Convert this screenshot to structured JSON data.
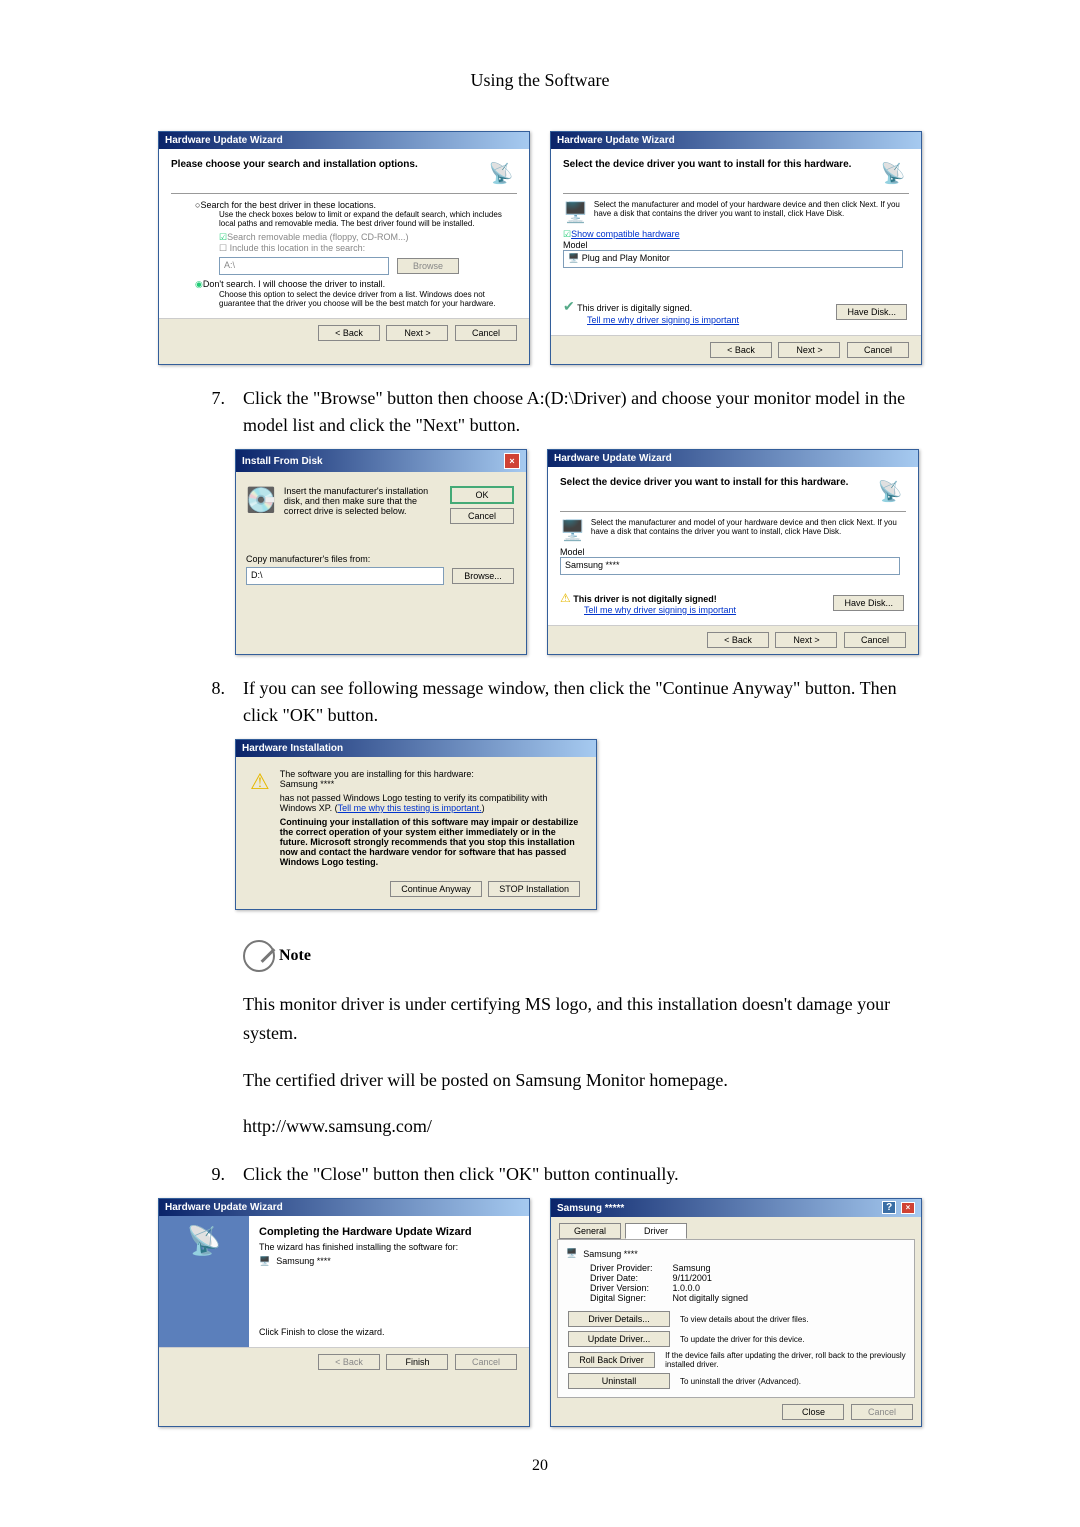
{
  "header": {
    "title": "Using the Software"
  },
  "step7": {
    "num": "7.",
    "text": "Click the \"Browse\" button then choose A:(D:\\Driver) and choose your monitor model in the model list and click the \"Next\" button."
  },
  "step8": {
    "num": "8.",
    "text": "If you can see following message window, then click the \"Continue Anyway\" button. Then click \"OK\" button."
  },
  "step9": {
    "num": "9.",
    "text": "Click the \"Close\" button then click \"OK\" button continually."
  },
  "note": {
    "label": "Note",
    "p1": "This monitor driver is under certifying MS logo, and this installation doesn't damage your system.",
    "p2": "The certified driver will be posted on Samsung Monitor homepage.",
    "url": "http://www.samsung.com/"
  },
  "dlg1": {
    "title": "Hardware Update Wizard",
    "head": "Please choose your search and installation options.",
    "opt1": "Search for the best driver in these locations.",
    "opt1_desc": "Use the check boxes below to limit or expand the default search, which includes local paths and removable media. The best driver found will be installed.",
    "chk1": "Search removable media (floppy, CD-ROM...)",
    "chk2": "Include this location in the search:",
    "path": "A:\\",
    "browse": "Browse",
    "opt2": "Don't search. I will choose the driver to install.",
    "opt2_desc": "Choose this option to select the device driver from a list. Windows does not guarantee that the driver you choose will be the best match for your hardware.",
    "back": "< Back",
    "next": "Next >",
    "cancel": "Cancel"
  },
  "dlg2": {
    "title": "Hardware Update Wizard",
    "head": "Select the device driver you want to install for this hardware.",
    "desc": "Select the manufacturer and model of your hardware device and then click Next. If you have a disk that contains the driver you want to install, click Have Disk.",
    "show_compat": "Show compatible hardware",
    "model_label": "Model",
    "model_row": "Plug and Play Monitor",
    "signed": "This driver is digitally signed.",
    "tell": "Tell me why driver signing is important",
    "have_disk": "Have Disk...",
    "back": "< Back",
    "next": "Next >",
    "cancel": "Cancel"
  },
  "dlg3": {
    "title": "Install From Disk",
    "msg": "Insert the manufacturer's installation disk, and then make sure that the correct drive is selected below.",
    "ok": "OK",
    "cancel": "Cancel",
    "copy_label": "Copy manufacturer's files from:",
    "path": "D:\\",
    "browse": "Browse..."
  },
  "dlg4": {
    "title": "Hardware Update Wizard",
    "head": "Select the device driver you want to install for this hardware.",
    "desc": "Select the manufacturer and model of your hardware device and then click Next. If you have a disk that contains the driver you want to install, click Have Disk.",
    "model_label": "Model",
    "model_row": "Samsung ****",
    "notsigned": "This driver is not digitally signed!",
    "tell": "Tell me why driver signing is important",
    "have_disk": "Have Disk...",
    "back": "< Back",
    "next": "Next >",
    "cancel": "Cancel"
  },
  "dlg5": {
    "title": "Hardware Installation",
    "line1": "The software you are installing for this hardware:",
    "hw": "Samsung ****",
    "line2": "has not passed Windows Logo testing to verify its compatibility with Windows XP. (",
    "tell": "Tell me why this testing is important.",
    "line2b": ")",
    "warn": "Continuing your installation of this software may impair or destabilize the correct operation of your system either immediately or in the future. Microsoft strongly recommends that you stop this installation now and contact the hardware vendor for software that has passed Windows Logo testing.",
    "continue": "Continue Anyway",
    "stop": "STOP Installation"
  },
  "dlg6": {
    "title": "Hardware Update Wizard",
    "head": "Completing the Hardware Update Wizard",
    "line1": "The wizard has finished installing the software for:",
    "hw": "Samsung ****",
    "line2": "Click Finish to close the wizard.",
    "back": "< Back",
    "finish": "Finish",
    "cancel": "Cancel"
  },
  "dlg7": {
    "title": "Samsung *****",
    "tab1": "General",
    "tab2": "Driver",
    "hw": "Samsung ****",
    "prov_l": "Driver Provider:",
    "prov_v": "Samsung",
    "date_l": "Driver Date:",
    "date_v": "9/11/2001",
    "ver_l": "Driver Version:",
    "ver_v": "1.0.0.0",
    "sign_l": "Digital Signer:",
    "sign_v": "Not digitally signed",
    "details": "Driver Details...",
    "details_d": "To view details about the driver files.",
    "update": "Update Driver...",
    "update_d": "To update the driver for this device.",
    "roll": "Roll Back Driver",
    "roll_d": "If the device fails after updating the driver, roll back to the previously installed driver.",
    "uninst": "Uninstall",
    "uninst_d": "To uninstall the driver (Advanced).",
    "close": "Close",
    "cancel": "Cancel"
  },
  "pagenum": "20"
}
